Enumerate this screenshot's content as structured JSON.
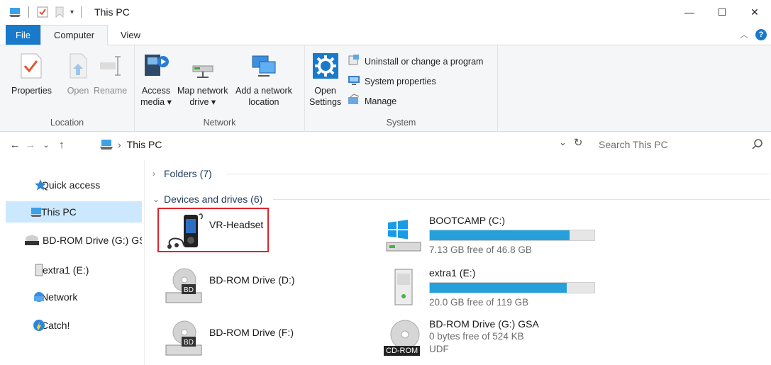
{
  "window": {
    "title": "This PC",
    "minimize": "—",
    "maximize": "☐",
    "close": "✕"
  },
  "ribbon_tabs": [
    {
      "label": "File"
    },
    {
      "label": "Computer"
    },
    {
      "label": "View"
    }
  ],
  "groups": {
    "location": {
      "label": "Location",
      "properties": "Properties",
      "open": "Open",
      "rename": "Rename"
    },
    "network": {
      "label": "Network",
      "access_media_1": "Access",
      "access_media_2": "media ▾",
      "map_drive_1": "Map network",
      "map_drive_2": "drive ▾",
      "add_location_1": "Add a network",
      "add_location_2": "location"
    },
    "system": {
      "label": "System",
      "open_settings_1": "Open",
      "open_settings_2": "Settings",
      "uninstall": "Uninstall or change a program",
      "system_properties": "System properties",
      "manage": "Manage"
    }
  },
  "address": {
    "path_root": "This PC",
    "search_placeholder": "Search This PC"
  },
  "sidebar": {
    "items": [
      {
        "label": "Quick access",
        "icon": "star-icon"
      },
      {
        "label": "This PC",
        "icon": "computer-icon",
        "selected": true
      },
      {
        "label": "BD-ROM Drive (G:) GSA",
        "icon": "cdrom-icon"
      },
      {
        "label": "extra1 (E:)",
        "icon": "usb-drive-icon"
      },
      {
        "label": "Network",
        "icon": "network-icon"
      },
      {
        "label": "Catch!",
        "icon": "catch-icon"
      }
    ]
  },
  "content": {
    "folders_header": "Folders (7)",
    "devices_header": "Devices and drives (6)",
    "devices": [
      {
        "name": "VR-Headset",
        "icon": "media-player-icon"
      },
      {
        "name": "BOOTCAMP (C:)",
        "free": "7.13 GB free of 46.8 GB",
        "used_fraction": 0.848,
        "icon": "windows-drive-icon"
      },
      {
        "name": "BD-ROM Drive (D:)",
        "icon": "bd-rom-icon"
      },
      {
        "name": "extra1 (E:)",
        "free": "20.0 GB free of 119 GB",
        "used_fraction": 0.832,
        "icon": "usb-drive-icon"
      },
      {
        "name": "BD-ROM Drive (F:)",
        "icon": "bd-rom-icon"
      },
      {
        "name": "BD-ROM Drive (G:) GSA",
        "free": "0 bytes free of 524 KB",
        "fs": "UDF",
        "badge": "CD-ROM",
        "icon": "cdrom-disc-icon"
      }
    ]
  },
  "colors": {
    "accent": "#1979ca",
    "selection": "#cce8ff",
    "bar_fill": "#26a0da",
    "highlight_box": "#e0242b"
  }
}
